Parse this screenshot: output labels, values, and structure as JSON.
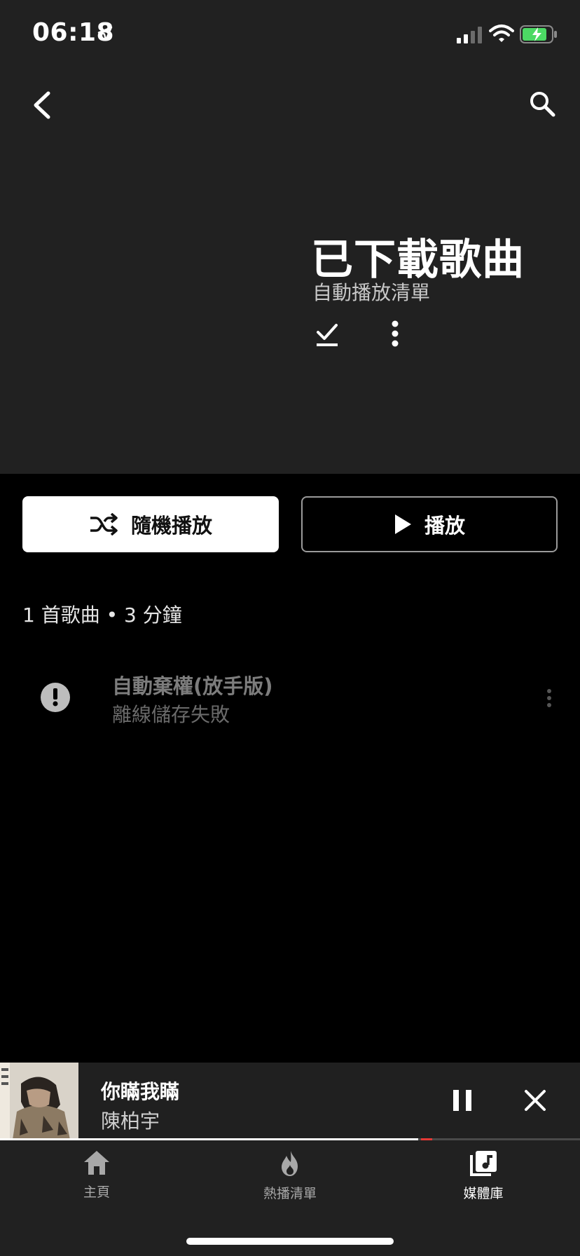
{
  "status_bar": {
    "time": "06:18"
  },
  "header": {
    "title": "已下載歌曲",
    "subtitle": "自動播放清單"
  },
  "actions": {
    "shuffle_label": "隨機播放",
    "play_label": "播放"
  },
  "summary": "1 首歌曲 • 3 分鐘",
  "songs": [
    {
      "title": "自動棄權(放手版)",
      "status": "離線儲存失敗"
    }
  ],
  "now_playing": {
    "title": "你瞞我瞞",
    "artist": "陳柏宇",
    "progress": 0.75
  },
  "bottom_nav": [
    {
      "label": "主頁",
      "icon": "home-icon",
      "active": false
    },
    {
      "label": "熱播清單",
      "icon": "flame-icon",
      "active": false
    },
    {
      "label": "媒體庫",
      "icon": "library-music-icon",
      "active": true
    }
  ],
  "colors": {
    "header_bg": "#212121",
    "background": "#000000",
    "progress_red": "#e53935"
  }
}
